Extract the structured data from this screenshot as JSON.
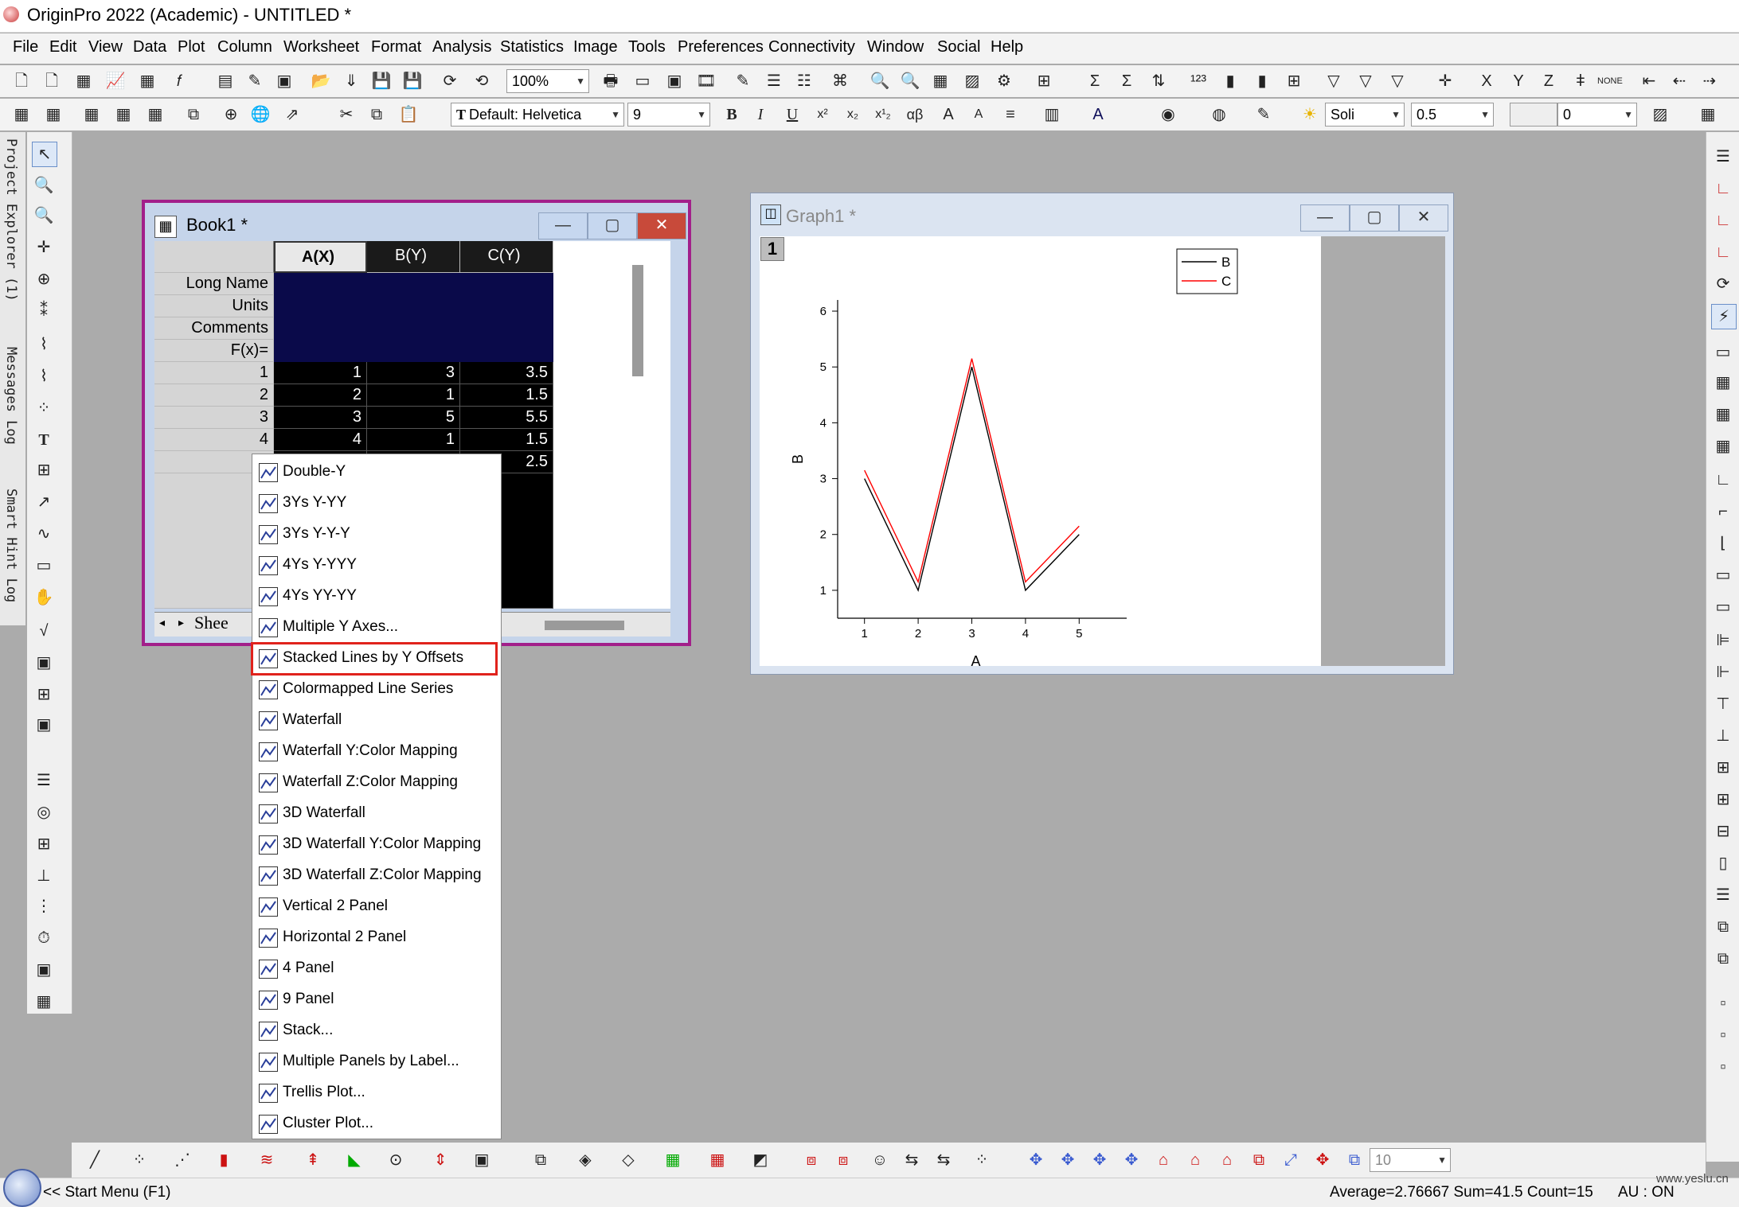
{
  "app": {
    "title": "OriginPro 2022 (Academic) - UNTITLED *"
  },
  "menu": [
    "File",
    "Edit",
    "View",
    "Data",
    "Plot",
    "Column",
    "Worksheet",
    "Format",
    "Analysis",
    "Statistics",
    "Image",
    "Tools",
    "Preferences",
    "Connectivity",
    "Window",
    "Social",
    "Help"
  ],
  "toolbar": {
    "zoom": "100%",
    "font": "Default: Helvetica",
    "font_size": "9",
    "line_style": "Soli",
    "line_width": "0.5",
    "fill_value": "0",
    "bottom_value": "10"
  },
  "side_panels": {
    "project_explorer": "Project Explorer (1)",
    "messages_log": "Messages Log",
    "smart_hint_log": "Smart Hint Log"
  },
  "book": {
    "title": "Book1 *",
    "columns": [
      "A(X)",
      "B(Y)",
      "C(Y)"
    ],
    "meta_rows": [
      "Long Name",
      "Units",
      "Comments",
      "F(x)="
    ],
    "rows": [
      {
        "n": "1",
        "a": "1",
        "b": "3",
        "c": "3.5"
      },
      {
        "n": "2",
        "a": "2",
        "b": "1",
        "c": "1.5"
      },
      {
        "n": "3",
        "a": "3",
        "b": "5",
        "c": "5.5"
      },
      {
        "n": "4",
        "a": "4",
        "b": "1",
        "c": "1.5"
      },
      {
        "n": "",
        "a": "",
        "b": "",
        "c": "2.5"
      }
    ],
    "sheet_tab": "Shee"
  },
  "graph": {
    "title": "Graph1 *",
    "layer": "1",
    "colors": {
      "B": "#000000",
      "C": "#ff0000"
    }
  },
  "chart_data": {
    "type": "line",
    "x": [
      1,
      2,
      3,
      4,
      5
    ],
    "series": [
      {
        "name": "B",
        "values": [
          3,
          1,
          5,
          1,
          2
        ]
      },
      {
        "name": "C",
        "values": [
          3.15,
          1.15,
          5.15,
          1.15,
          2.15
        ]
      }
    ],
    "xlabel": "A",
    "ylabel": "B",
    "xlim": [
      0.5,
      5.5
    ],
    "ylim": [
      0.5,
      6.2
    ],
    "xticks": [
      "1",
      "2",
      "3",
      "4",
      "5"
    ],
    "yticks": [
      "1",
      "2",
      "3",
      "4",
      "5",
      "6"
    ],
    "legend": "top-right",
    "grid": false
  },
  "context_menu": [
    "Double-Y",
    "3Ys Y-YY",
    "3Ys Y-Y-Y",
    "4Ys Y-YYY",
    "4Ys YY-YY",
    "Multiple Y Axes...",
    "Stacked Lines by Y Offsets",
    "Colormapped Line Series",
    "Waterfall",
    "Waterfall Y:Color Mapping",
    "Waterfall Z:Color Mapping",
    "3D Waterfall",
    "3D Waterfall Y:Color Mapping",
    "3D Waterfall Z:Color Mapping",
    "Vertical 2 Panel",
    "Horizontal 2 Panel",
    "4 Panel",
    "9 Panel",
    "Stack...",
    "Multiple Panels by Label...",
    "Trellis Plot...",
    "Cluster Plot..."
  ],
  "status": {
    "start_menu": "<< Start Menu (F1)",
    "stats": "Average=2.76667 Sum=41.5 Count=15",
    "au": "AU : ON",
    "watermark": "www.yeslu.cn"
  }
}
